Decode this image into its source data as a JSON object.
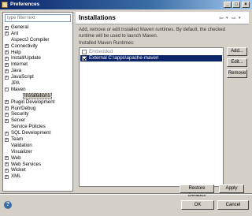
{
  "window": {
    "title": "Preferences",
    "minimize": "_",
    "maximize": "□",
    "close": "×"
  },
  "filter": {
    "placeholder": "type filter text"
  },
  "tree": [
    {
      "label": "General",
      "expandable": true
    },
    {
      "label": "Ant",
      "expandable": true
    },
    {
      "label": "AspectJ Compiler",
      "expandable": false
    },
    {
      "label": "Connectivity",
      "expandable": true
    },
    {
      "label": "Help",
      "expandable": true
    },
    {
      "label": "Install/Update",
      "expandable": true
    },
    {
      "label": "Internet",
      "expandable": true
    },
    {
      "label": "Java",
      "expandable": true
    },
    {
      "label": "JavaScript",
      "expandable": true
    },
    {
      "label": "JPA",
      "expandable": false
    },
    {
      "label": "Maven",
      "expandable": true,
      "expanded": true
    },
    {
      "label": "Installations",
      "child": true,
      "selected": true
    },
    {
      "label": "Plugin Development",
      "expandable": true
    },
    {
      "label": "Run/Debug",
      "expandable": true
    },
    {
      "label": "Security",
      "expandable": true
    },
    {
      "label": "Server",
      "expandable": true
    },
    {
      "label": "Service Policies",
      "expandable": false
    },
    {
      "label": "SQL Development",
      "expandable": true
    },
    {
      "label": "Team",
      "expandable": true
    },
    {
      "label": "Validation",
      "expandable": false
    },
    {
      "label": "Visualizer",
      "expandable": false
    },
    {
      "label": "Web",
      "expandable": true
    },
    {
      "label": "Web Services",
      "expandable": true
    },
    {
      "label": "Wicket",
      "expandable": true
    },
    {
      "label": "XML",
      "expandable": true
    }
  ],
  "page": {
    "title": "Installations",
    "description": "Add, remove or edit installed Maven runtimes. By default, the checked runtime will be used to launch Maven.",
    "list_label": "Installed Maven Runtimes:",
    "runtimes": [
      {
        "label": "Embedded",
        "checked": false,
        "selected": false,
        "disabled": true
      },
      {
        "label": "External C:\\apps\\apache-maven",
        "checked": true,
        "selected": true,
        "disabled": false
      }
    ],
    "buttons": {
      "add": "Add...",
      "edit": "Edit...",
      "remove": "Remove"
    },
    "restore_defaults": "Restore Defaults",
    "apply": "Apply"
  },
  "nav": {
    "back": "⇦",
    "back_menu": "▾",
    "forward": "⇨",
    "forward_menu": "▾"
  },
  "footer": {
    "help": "?",
    "ok": "OK",
    "cancel": "Cancel"
  }
}
